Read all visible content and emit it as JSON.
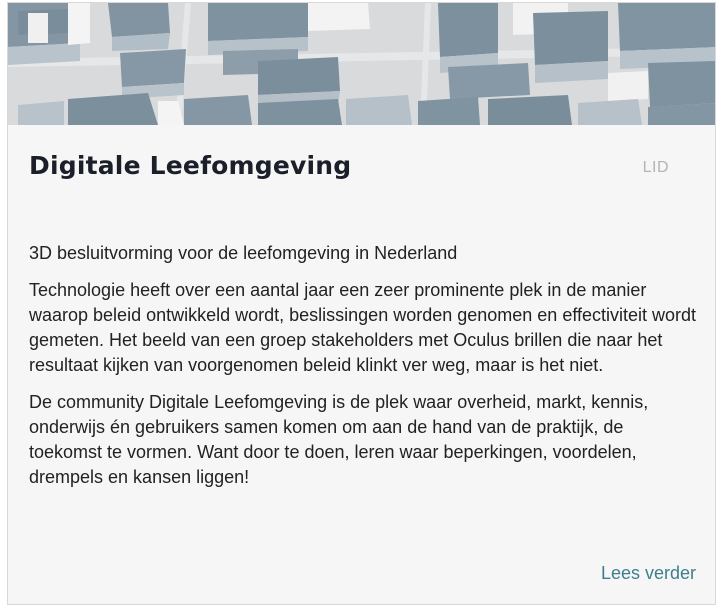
{
  "card": {
    "title": "Digitale Leefomgeving",
    "badge": "LID",
    "subtitle": "3D besluitvorming voor de leefomgeving in Nederland",
    "paragraphs": [
      "Technologie heeft over een aantal jaar een zeer prominente plek in de manier waarop beleid ontwikkeld wordt, beslissingen worden genomen en effectiviteit wordt gemeten. Het beeld van een groep stakeholders met Oculus brillen die naar het resultaat kijken van voorgenomen beleid klinkt ver weg, maar is het niet.",
      "De community Digitale Leefomgeving is de plek waar overheid, markt, kennis, onderwijs én gebruikers samen komen om aan de hand van de praktijk, de toekomst te vormen. Want door te doen, leren waar beperkingen, voordelen, drempels en kansen liggen!"
    ],
    "read_more": "Lees verder"
  },
  "colors": {
    "card_background": "#f6f6f6",
    "link": "#3f7e8c",
    "title": "#1b1f2a",
    "badge": "#b4b4b4",
    "building_roof": "#7f929f",
    "building_side": "#b6c1c9",
    "ground": "#d9dadb"
  }
}
